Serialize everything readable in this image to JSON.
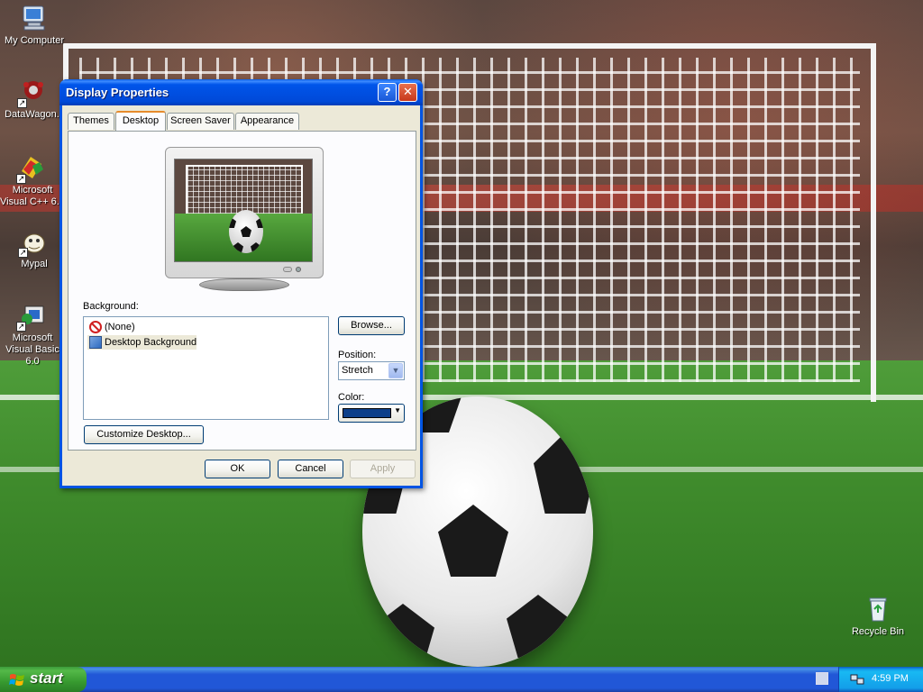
{
  "desktop": {
    "icons": [
      {
        "label": "My Computer",
        "icon": "my-computer-icon"
      },
      {
        "label": "DataWagon..",
        "icon": "datawagon-icon"
      },
      {
        "label": "Microsoft Visual C++ 6.0",
        "icon": "visual-cpp-icon"
      },
      {
        "label": "Mypal",
        "icon": "mypal-icon"
      },
      {
        "label": "Microsoft Visual Basic 6.0",
        "icon": "visual-basic-icon"
      },
      {
        "label": "Recycle Bin",
        "icon": "recycle-bin-icon"
      }
    ]
  },
  "dialog": {
    "title": "Display Properties",
    "help_glyph": "?",
    "close_glyph": "✕",
    "tabs": [
      {
        "label": "Themes",
        "active": false
      },
      {
        "label": "Desktop",
        "active": true
      },
      {
        "label": "Screen Saver",
        "active": false
      },
      {
        "label": "Appearance",
        "active": false
      }
    ],
    "background_label": "Background:",
    "background_items": [
      {
        "label": "(None)",
        "icon": "no-symbol-icon",
        "selected": false
      },
      {
        "label": "Desktop Background",
        "icon": "desktop-background-icon",
        "selected": true
      }
    ],
    "browse_button": "Browse...",
    "position_label": "Position:",
    "position_value": "Stretch",
    "color_label": "Color:",
    "color_value": "#0c3f8a",
    "customize_button": "Customize Desktop...",
    "ok_button": "OK",
    "cancel_button": "Cancel",
    "apply_button": "Apply"
  },
  "taskbar": {
    "start_label": "start",
    "clock": "4:59 PM"
  }
}
